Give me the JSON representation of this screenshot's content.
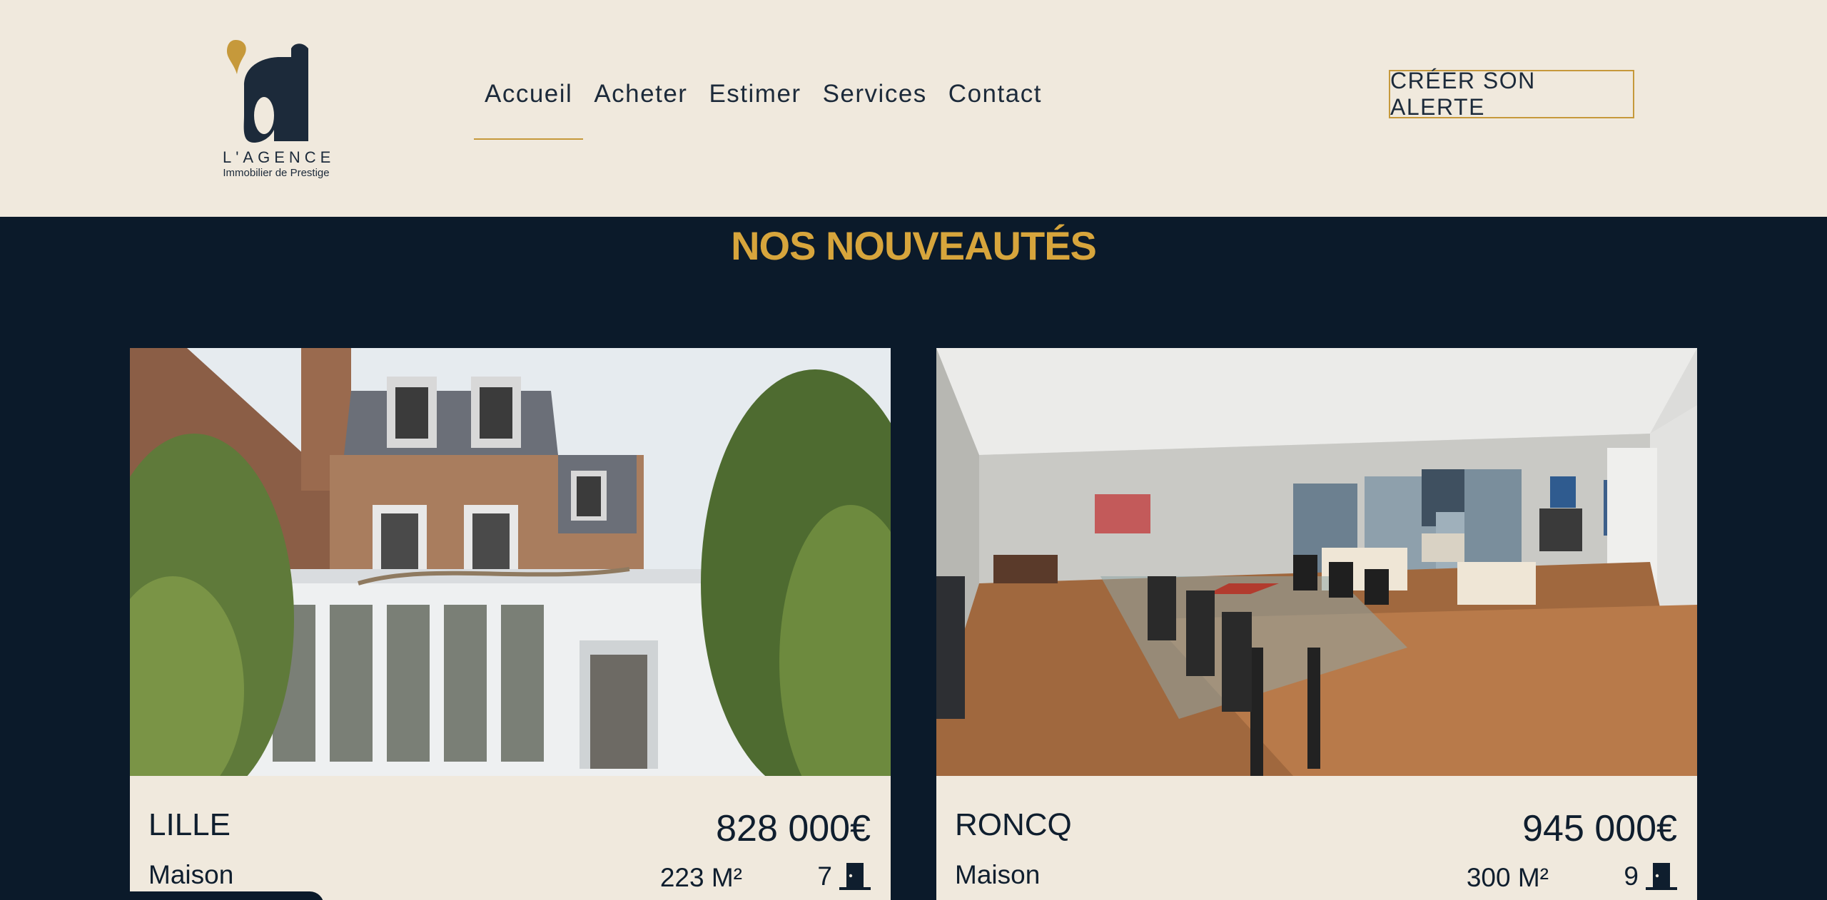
{
  "logo": {
    "wordmark": "L'AGENCE",
    "tagline": "Immobilier de Prestige"
  },
  "nav": {
    "items": [
      "Accueil",
      "Acheter",
      "Estimer",
      "Services",
      "Contact"
    ],
    "active": "Accueil"
  },
  "alert_button": {
    "label": "CRÉER SON ALERTE"
  },
  "section": {
    "title": "NOS NOUVEAUTÉS"
  },
  "listings": [
    {
      "city": "LILLE",
      "type": "Maison",
      "price": "828 000€",
      "surface": "223 M²",
      "rooms": "7"
    },
    {
      "city": "RONCQ",
      "type": "Maison",
      "price": "945 000€",
      "surface": "300 M²",
      "rooms": "9"
    }
  ],
  "colors": {
    "accent": "#c6993b",
    "title": "#d7a53c",
    "dark": "#0b1a2a",
    "cream": "#f0e9dd"
  },
  "icons": {
    "rooms": "door-icon"
  }
}
